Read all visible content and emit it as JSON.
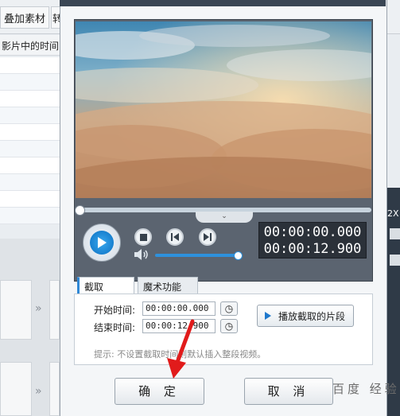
{
  "background": {
    "tab_label": "叠加素材",
    "tab2_label": "转",
    "header_text": "影片中的时间",
    "right_label": "2X"
  },
  "dialog": {
    "timecode_current": "00:00:00.000",
    "timecode_total": "00:00:12.900",
    "tabs": [
      "截取",
      "魔术功能"
    ],
    "start_label": "开始时间:",
    "start_value": "00:00:00.000",
    "end_label": "结束时间:",
    "end_value": "00:00:12.900",
    "play_segment_label": "播放截取的片段",
    "hint": "提示: 不设置截取时间则默认插入整段视频。",
    "ok_label": "确 定",
    "cancel_label": "取 消",
    "volume_level": 1.0,
    "seek_position": 0.0
  },
  "watermark": "百度 经验",
  "colors": {
    "accent": "#2f88d6",
    "play": "#0a6fc2",
    "arrow": "#e11b1b"
  }
}
